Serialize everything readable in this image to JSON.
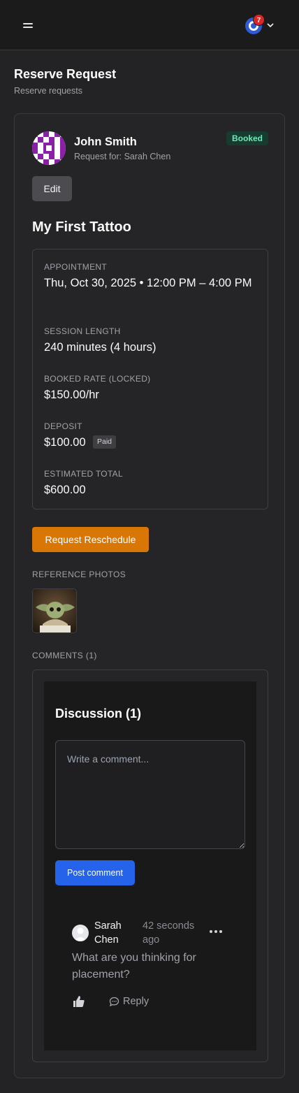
{
  "header": {
    "notification_count": "7"
  },
  "page": {
    "title": "Reserve Request",
    "subtitle": "Reserve requests"
  },
  "request": {
    "client_name": "John Smith",
    "request_for": "Request for: Sarah Chen",
    "status": "Booked",
    "edit_label": "Edit",
    "title": "My First Tattoo",
    "details": {
      "appointment_label": "APPOINTMENT",
      "appointment_value": "Thu, Oct 30, 2025 • 12:00 PM – 4:00 PM",
      "session_label": "SESSION LENGTH",
      "session_value": "240 minutes (4 hours)",
      "rate_label": "BOOKED RATE (LOCKED)",
      "rate_value": "$150.00/hr",
      "deposit_label": "DEPOSIT",
      "deposit_value": "$100.00",
      "deposit_status": "Paid",
      "total_label": "ESTIMATED TOTAL",
      "total_value": "$600.00"
    },
    "reschedule_label": "Request Reschedule",
    "reference_photos_label": "REFERENCE PHOTOS",
    "comments_label": "COMMENTS (1)"
  },
  "discussion": {
    "title": "Discussion (1)",
    "input_placeholder": "Write a comment...",
    "post_label": "Post comment",
    "comments": [
      {
        "author": "Sarah Chen",
        "time": "42 seconds ago",
        "text": "What are you thinking for placement?",
        "reply_label": "Reply"
      }
    ]
  },
  "colors": {
    "accent_orange": "#d97706",
    "accent_blue": "#2563eb",
    "status_green": "#6ee7b7",
    "badge_red": "#dc2626"
  },
  "icons": [
    "menu-icon",
    "app-logo-icon",
    "chevron-down-icon",
    "more-options-icon",
    "thumbs-up-icon",
    "chat-bubble-icon"
  ]
}
